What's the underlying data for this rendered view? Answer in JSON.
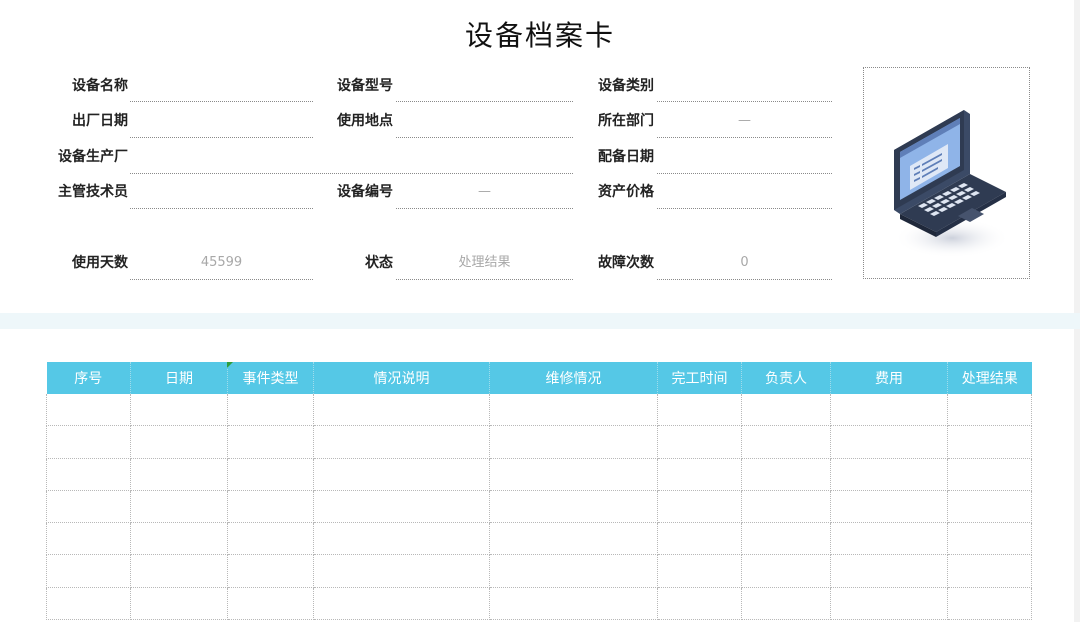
{
  "title": "设备档案卡",
  "fields": {
    "device_name": {
      "label": "设备名称",
      "value": ""
    },
    "device_model": {
      "label": "设备型号",
      "value": ""
    },
    "device_category": {
      "label": "设备类别",
      "value": ""
    },
    "factory_date": {
      "label": "出厂日期",
      "value": ""
    },
    "use_location": {
      "label": "使用地点",
      "value": ""
    },
    "department": {
      "label": "所在部门",
      "value": "—"
    },
    "manufacturer": {
      "label": "设备生产厂",
      "value": ""
    },
    "assign_date": {
      "label": "配备日期",
      "value": ""
    },
    "supervisor": {
      "label": "主管技术员",
      "value": ""
    },
    "device_number": {
      "label": "设备编号",
      "value": "—"
    },
    "asset_price": {
      "label": "资产价格",
      "value": ""
    },
    "days_used": {
      "label": "使用天数",
      "value": "45599"
    },
    "status": {
      "label": "状态",
      "value": "处理结果"
    },
    "fault_count": {
      "label": "故障次数",
      "value": "0"
    }
  },
  "table": {
    "columns": [
      "序号",
      "日期",
      "事件类型",
      "情况说明",
      "维修情况",
      "完工时间",
      "负责人",
      "费用",
      "处理结果"
    ],
    "row_count": 7
  },
  "colors": {
    "header_bg": "#55c8e6",
    "band_bg": "#eef7fa",
    "laptop_body": "#3b4a66",
    "laptop_screen": "#8fb4e8"
  },
  "icons": {
    "device_image": "laptop-icon"
  }
}
